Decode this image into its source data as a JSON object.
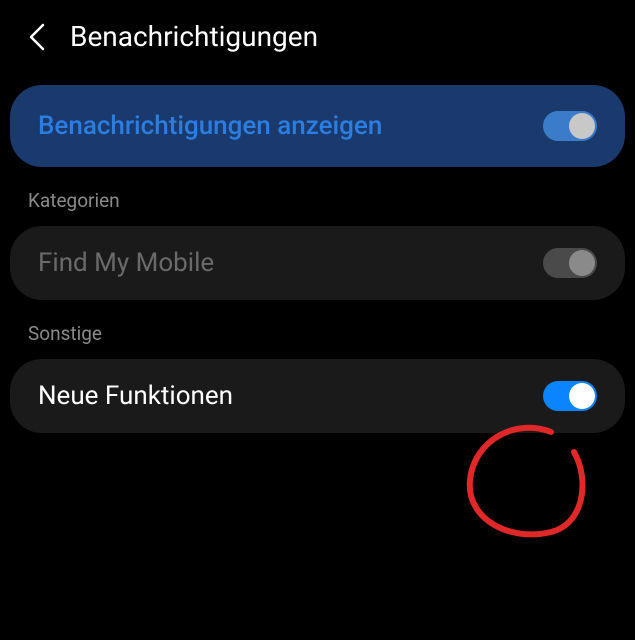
{
  "header": {
    "title": "Benachrichtigungen"
  },
  "main": {
    "label": "Benachrichtigungen anzeigen"
  },
  "sections": {
    "categories": {
      "label": "Kategorien",
      "items": {
        "findMyMobile": {
          "label": "Find My Mobile"
        }
      }
    },
    "other": {
      "label": "Sonstige",
      "items": {
        "newFeatures": {
          "label": "Neue Funktionen"
        }
      }
    }
  }
}
